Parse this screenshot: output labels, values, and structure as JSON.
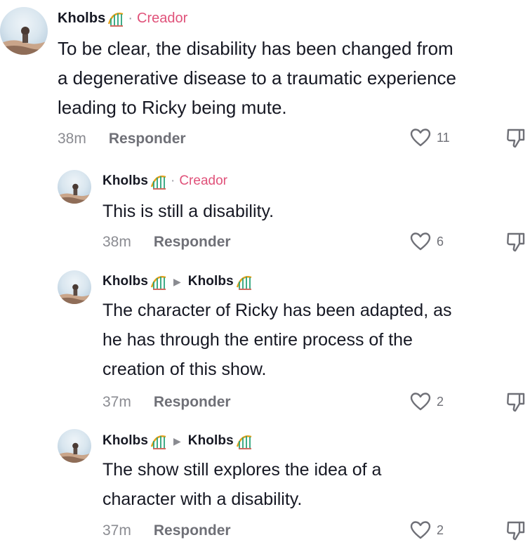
{
  "comments": [
    {
      "username": "Kholbs",
      "badge": "Creador",
      "separator": "·",
      "text_lines": [
        "To be clear, the disability has been changed from",
        "a degenerative disease to a traumatic experience",
        "leading to Ricky being mute."
      ],
      "time": "38m",
      "reply_label": "Responder",
      "likes": "11"
    },
    {
      "username": "Kholbs",
      "badge": "Creador",
      "separator": "·",
      "text_lines": [
        "This is still a disability."
      ],
      "time": "38m",
      "reply_label": "Responder",
      "likes": "6"
    },
    {
      "username": "Kholbs",
      "reply_to": "Kholbs",
      "reply_arrow": "▶",
      "text_lines": [
        "The character of Ricky has been adapted, as",
        "he has through the entire process of the",
        "creation of this show."
      ],
      "time": "37m",
      "reply_label": "Responder",
      "likes": "2"
    },
    {
      "username": "Kholbs",
      "reply_to": "Kholbs",
      "reply_arrow": "▶",
      "text_lines": [
        "The show still explores the idea of a",
        "character with a disability."
      ],
      "time": "37m",
      "reply_label": "Responder",
      "likes": "2"
    }
  ],
  "icons": {
    "username_emoji": "roller-coaster-emoji",
    "like": "heart-outline-icon",
    "dislike": "thumbs-down-outline-icon"
  },
  "colors": {
    "creator_badge": "#e0527a",
    "text": "#161823",
    "muted": "#8a8b91"
  }
}
